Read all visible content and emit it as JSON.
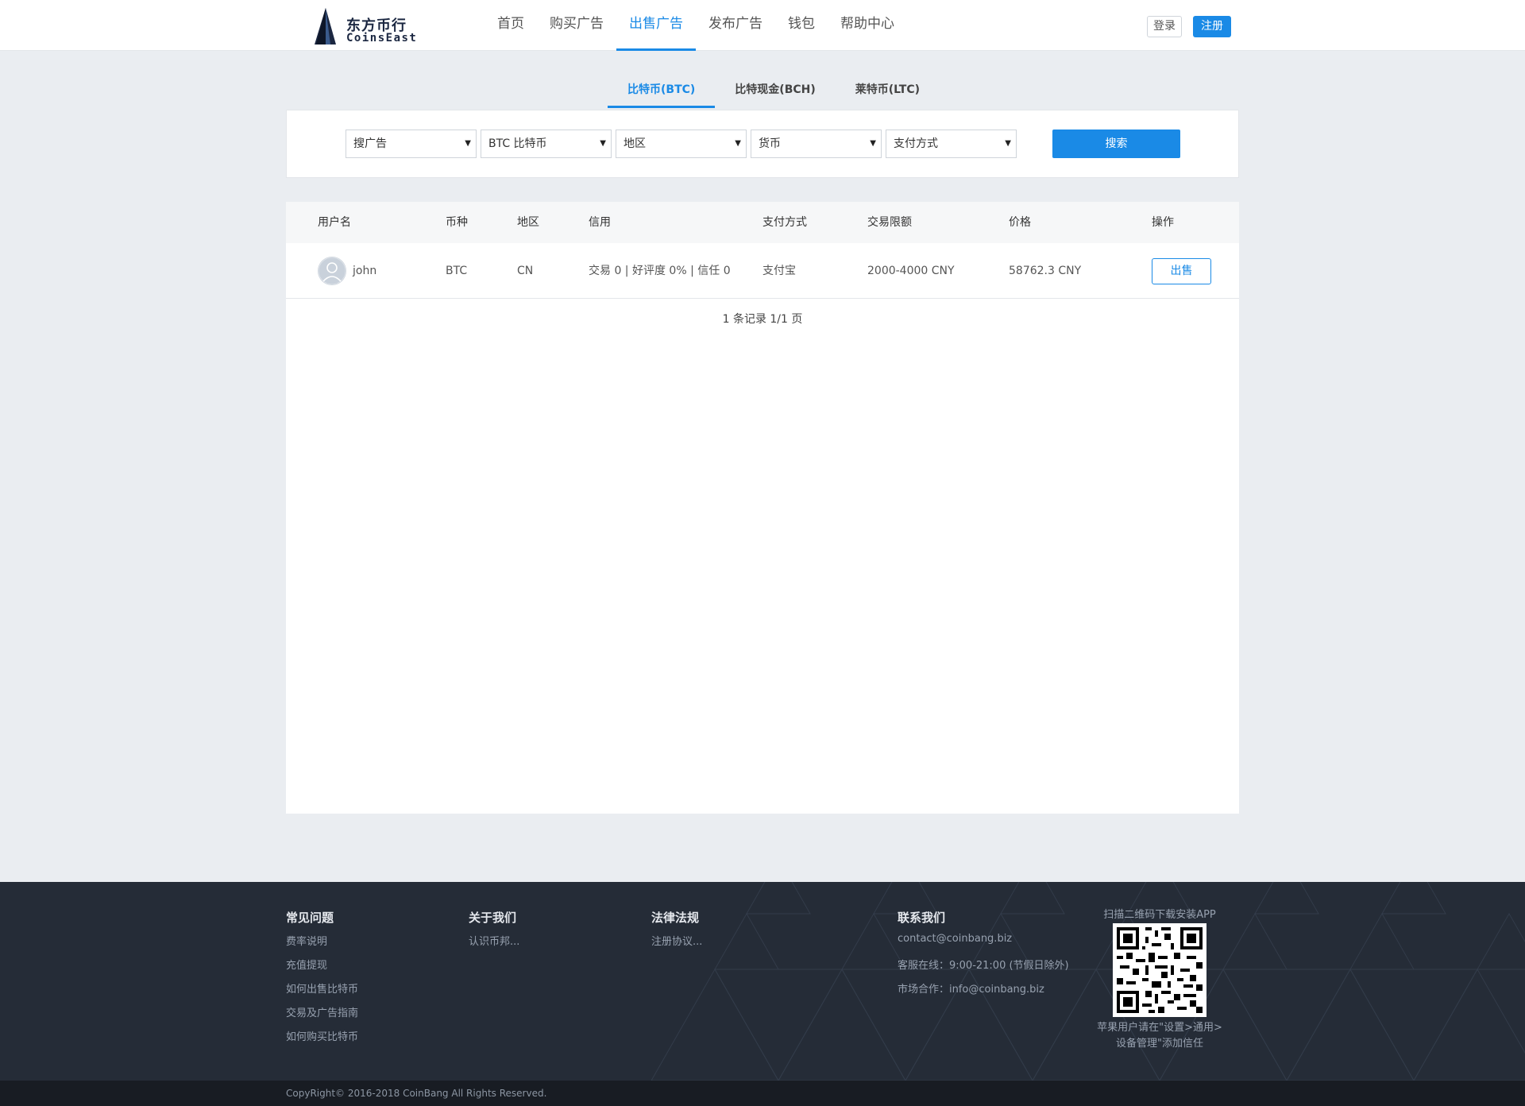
{
  "brand": {
    "name_cn": "东方币行",
    "name_en": "CoinsEast"
  },
  "nav": {
    "items": [
      {
        "label": "首页"
      },
      {
        "label": "购买广告"
      },
      {
        "label": "出售广告",
        "active": true
      },
      {
        "label": "发布广告"
      },
      {
        "label": "钱包"
      },
      {
        "label": "帮助中心"
      }
    ],
    "login_label": "登录",
    "register_label": "注册"
  },
  "coin_tabs": [
    {
      "label": "比特币(BTC)",
      "active": true
    },
    {
      "label": "比特现金(BCH)"
    },
    {
      "label": "莱特币(LTC)"
    }
  ],
  "filters": {
    "ad_type": "搜广告",
    "coin": "BTC 比特币",
    "region": "地区",
    "currency": "货币",
    "payment": "支付方式",
    "search_label": "搜索",
    "caret": "▼"
  },
  "table": {
    "headers": {
      "username": "用户名",
      "coin": "币种",
      "region": "地区",
      "credit": "信用",
      "payment": "支付方式",
      "limit": "交易限额",
      "price": "价格",
      "action": "操作"
    },
    "rows": [
      {
        "username": "john",
        "coin": "BTC",
        "region": "CN",
        "credit": "交易 0 | 好评度 0% | 信任 0",
        "payment": "支付宝",
        "limit": "2000-4000 CNY",
        "price": "58762.3 CNY",
        "action": "出售"
      }
    ],
    "pagination": "1 条记录 1/1 页"
  },
  "footer": {
    "faq": {
      "title": "常见问题",
      "links": [
        "费率说明",
        "充值提现",
        "如何出售比特币",
        "交易及广告指南",
        "如何购买比特币"
      ]
    },
    "about": {
      "title": "关于我们",
      "links": [
        "认识币邦..."
      ]
    },
    "legal": {
      "title": "法律法规",
      "links": [
        "注册协议..."
      ]
    },
    "contact": {
      "title": "联系我们",
      "lines": [
        "contact@coinbang.biz",
        "客服在线：9:00-21:00 (节假日除外)",
        "市场合作：info@coinbang.biz"
      ]
    },
    "app": {
      "caption": "扫描二维码下载安装APP",
      "note_line1": "苹果用户请在\"设置>通用>",
      "note_line2": "设备管理\"添加信任"
    },
    "copyright": "CopyRight© 2016-2018 CoinBang All Rights Reserved."
  },
  "colors": {
    "accent": "#1a8ae6",
    "page_bg": "#eaedf1",
    "footer_bg": "#252c37",
    "copyright_bg": "#181c23"
  },
  "icons": {
    "logo": "sail-logo-icon",
    "avatar": "user-avatar-icon",
    "dropdown": "caret-down-icon",
    "app_download": "qr-code-icon"
  }
}
